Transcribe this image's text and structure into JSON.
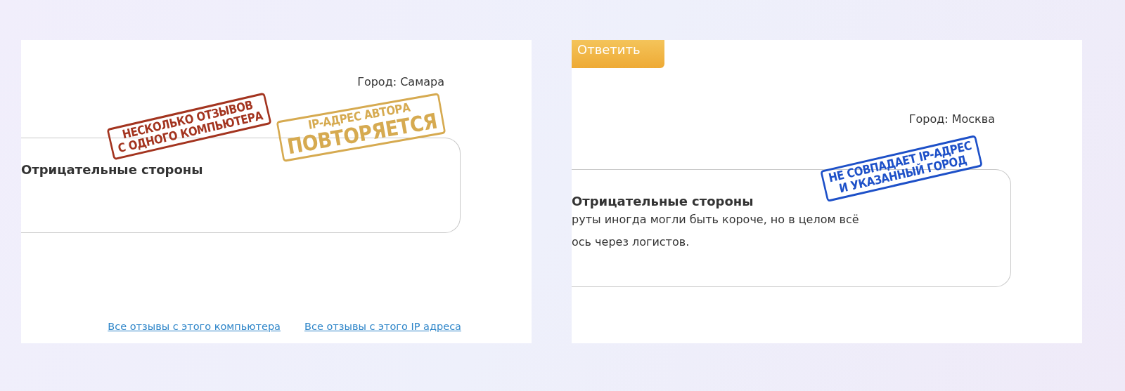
{
  "panels": [
    {
      "city": "Город: Самара",
      "card": {
        "heading": "Отрицательные стороны"
      },
      "stamps": [
        {
          "color": "#a3341f",
          "lines": [
            {
              "text": "НЕСКОЛЬКО ОТЗЫВОВ",
              "large": false
            },
            {
              "text": "С ОДНОГО КОМПЬЮТЕРА",
              "large": false
            }
          ]
        },
        {
          "color": "#d6aa50",
          "lines": [
            {
              "text": "IP-АДРЕС АВТОРА",
              "large": false
            },
            {
              "text": "ПОВТОРЯЕТСЯ",
              "large": true
            }
          ]
        }
      ],
      "links": [
        "Все отзывы с этого компьютера",
        "Все отзывы с этого IP адреса"
      ]
    },
    {
      "reply_button": "Ответить",
      "city": "Город: Москва",
      "card": {
        "heading": "Отрицательные стороны",
        "lines": [
          "руты иногда могли быть короче, но в целом всё",
          "ось через логистов."
        ]
      },
      "stamps": [
        {
          "color": "#1d50c8",
          "lines": [
            {
              "text": "НЕ СОВПАДАЕТ IP-АДРЕС",
              "large": false
            },
            {
              "text": "И УКАЗАННЫЙ ГОРОД",
              "large": false
            }
          ]
        }
      ]
    }
  ]
}
